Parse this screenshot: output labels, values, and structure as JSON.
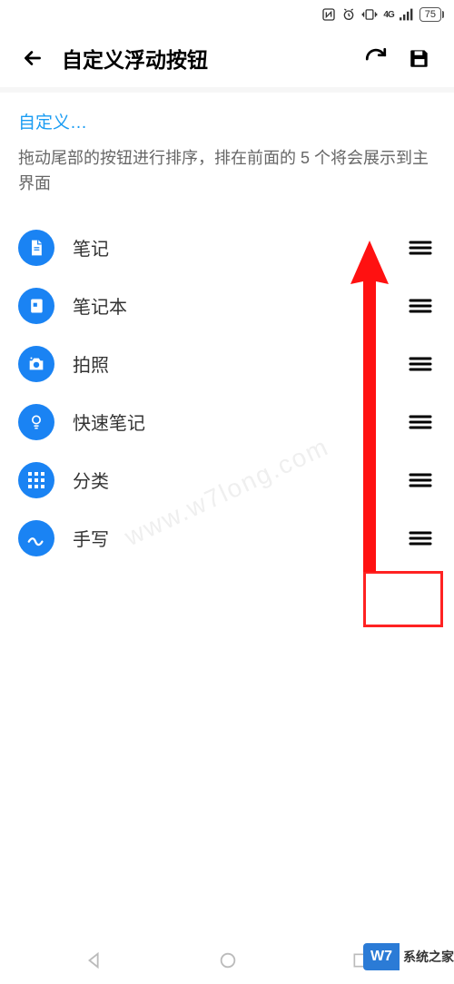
{
  "status": {
    "battery": "75"
  },
  "header": {
    "title": "自定义浮动按钮"
  },
  "section": {
    "link": "自定义…",
    "desc": "拖动尾部的按钮进行排序，排在前面的 5 个将会展示到主界面"
  },
  "items": [
    {
      "label": "笔记"
    },
    {
      "label": "笔记本"
    },
    {
      "label": "拍照"
    },
    {
      "label": "快速笔记"
    },
    {
      "label": "分类"
    },
    {
      "label": "手写"
    }
  ],
  "watermark": "www.w7long.com",
  "brand": {
    "logo": "W7",
    "text": "系统之家"
  }
}
